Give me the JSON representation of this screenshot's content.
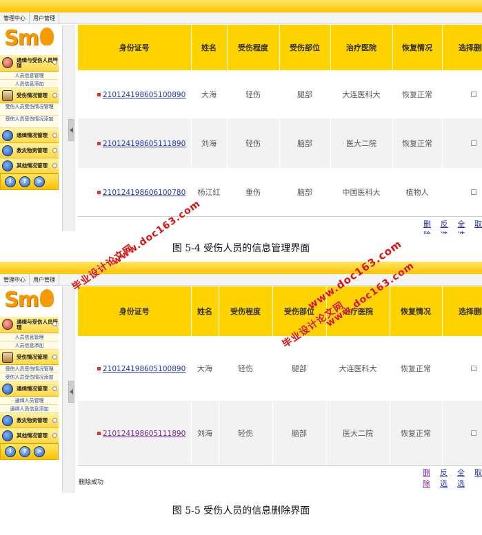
{
  "nav": {
    "tab1": "管理中心",
    "tab2": "用户管理"
  },
  "sidebar": {
    "logo": "Sm",
    "sections": [
      {
        "label": "通缉与受伤人员管理"
      },
      {
        "label": "受伤情况管理"
      },
      {
        "label": "通缉情况管理"
      },
      {
        "label": "救灾物资管理"
      },
      {
        "label": "其他情况管理"
      }
    ],
    "sub_personnel": [
      "人员信息管理",
      "人员信息添加"
    ],
    "sub_injury": [
      "受伤人员受伤情况管理",
      "受伤人员受伤情况添加"
    ],
    "sub_wanted": [
      "通缉人员管理",
      "通缉人员信息添加"
    ],
    "buttons": [
      "!",
      "?",
      ">"
    ]
  },
  "table": {
    "headers": [
      "身份证号",
      "姓名",
      "受伤程度",
      "受伤部位",
      "治疗医院",
      "恢复情况",
      "选择删除"
    ],
    "rows_top": [
      [
        "210124198605100890",
        "大海",
        "轻伤",
        "腿部",
        "大连医科大",
        "恢复正常"
      ],
      [
        "210124198605111890",
        "刘海",
        "轻伤",
        "脑部",
        "医大二院",
        "恢复正常"
      ],
      [
        "210124198606100780",
        "杨江红",
        "重伤",
        "脑部",
        "中国医科大",
        "植物人"
      ]
    ],
    "rows_bottom": [
      [
        "210124198605100890",
        "大海",
        "轻伤",
        "腿部",
        "大连医科大",
        "恢复正常"
      ],
      [
        "210124198605111890",
        "刘海",
        "轻伤",
        "脑部",
        "医大二院",
        "恢复正常"
      ]
    ],
    "actions": [
      "删除",
      "反选",
      "全选",
      "取"
    ]
  },
  "status": "删除成功",
  "captions": [
    "图 5-4  受伤人员的信息管理界面",
    "图 5-5  受伤人员的信息删除界面"
  ],
  "watermarks": {
    "site": "www.doc163.com",
    "cn": "毕业设计论文网"
  }
}
